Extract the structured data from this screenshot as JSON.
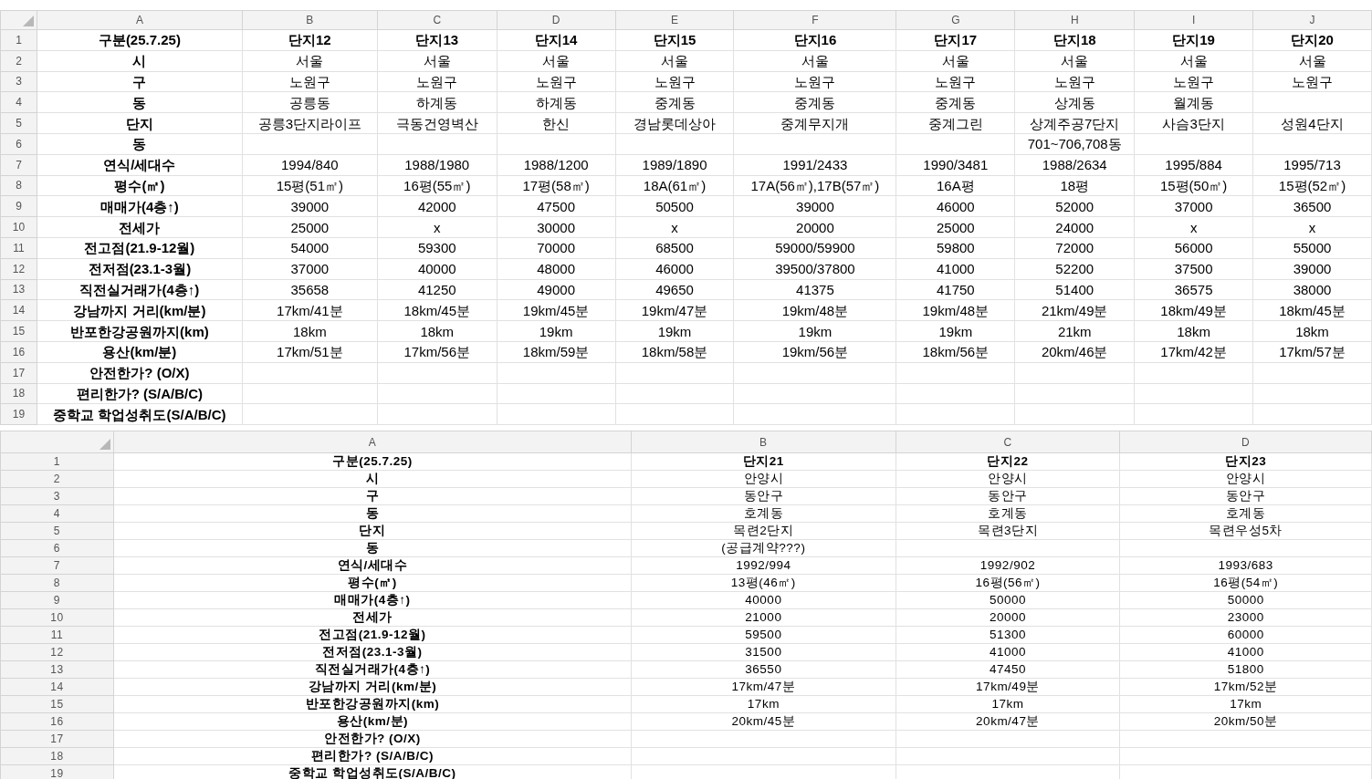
{
  "sheets": [
    {
      "columns": [
        "A",
        "B",
        "C",
        "D",
        "E",
        "F",
        "G",
        "H",
        "I",
        "J"
      ],
      "rows": [
        {
          "number": "1",
          "cells": [
            "구분(25.7.25)",
            "단지12",
            "단지13",
            "단지14",
            "단지15",
            "단지16",
            "단지17",
            "단지18",
            "단지19",
            "단지20"
          ]
        },
        {
          "number": "2",
          "cells": [
            "시",
            "서울",
            "서울",
            "서울",
            "서울",
            "서울",
            "서울",
            "서울",
            "서울",
            "서울"
          ]
        },
        {
          "number": "3",
          "cells": [
            "구",
            "노원구",
            "노원구",
            "노원구",
            "노원구",
            "노원구",
            "노원구",
            "노원구",
            "노원구",
            "노원구"
          ]
        },
        {
          "number": "4",
          "cells": [
            "동",
            "공릉동",
            "하계동",
            "하계동",
            "중계동",
            "중계동",
            "중계동",
            "상계동",
            "월계동",
            null
          ]
        },
        {
          "number": "5",
          "cells": [
            "단지",
            "공릉3단지라이프",
            "극동건영벽산",
            "한신",
            "경남롯데상아",
            "중계무지개",
            "중계그린",
            "상계주공7단지",
            "사슴3단지",
            "성원4단지"
          ]
        },
        {
          "number": "6",
          "cells": [
            "동",
            null,
            null,
            null,
            null,
            null,
            null,
            "701~706,708동",
            null,
            null
          ]
        },
        {
          "number": "7",
          "cells": [
            "연식/세대수",
            "1994/840",
            "1988/1980",
            "1988/1200",
            "1989/1890",
            "1991/2433",
            "1990/3481",
            "1988/2634",
            "1995/884",
            "1995/713"
          ]
        },
        {
          "number": "8",
          "cells": [
            "평수(㎡)",
            "15평(51㎡)",
            "16평(55㎡)",
            "17평(58㎡)",
            "18A(61㎡)",
            "17A(56㎡),17B(57㎡)",
            "16A평",
            "18평",
            "15평(50㎡)",
            "15평(52㎡)"
          ]
        },
        {
          "number": "9",
          "cells": [
            "매매가(4층↑)",
            "39000",
            "42000",
            "47500",
            "50500",
            "39000",
            "46000",
            "52000",
            "37000",
            "36500"
          ]
        },
        {
          "number": "10",
          "cells": [
            "전세가",
            "25000",
            "x",
            "30000",
            "x",
            "20000",
            "25000",
            "24000",
            "x",
            "x"
          ]
        },
        {
          "number": "11",
          "cells": [
            "전고점(21.9-12월)",
            "54000",
            "59300",
            "70000",
            "68500",
            "59000/59900",
            "59800",
            "72000",
            "56000",
            "55000"
          ]
        },
        {
          "number": "12",
          "cells": [
            "전저점(23.1-3월)",
            "37000",
            "40000",
            "48000",
            "46000",
            "39500/37800",
            "41000",
            "52200",
            "37500",
            "39000"
          ]
        },
        {
          "number": "13",
          "cells": [
            "직전실거래가(4층↑)",
            "35658",
            "41250",
            "49000",
            "49650",
            "41375",
            "41750",
            "51400",
            "36575",
            "38000"
          ]
        },
        {
          "number": "14",
          "cells": [
            "강남까지 거리(km/분)",
            "17km/41분",
            "18km/45분",
            "19km/45분",
            "19km/47분",
            "19km/48분",
            "19km/48분",
            "21km/49분",
            "18km/49분",
            "18km/45분"
          ]
        },
        {
          "number": "15",
          "cells": [
            "반포한강공원까지(km)",
            "18km",
            "18km",
            "19km",
            "19km",
            "19km",
            "19km",
            "21km",
            "18km",
            "18km"
          ]
        },
        {
          "number": "16",
          "cells": [
            "용산(km/분)",
            "17km/51분",
            "17km/56분",
            "18km/59분",
            "18km/58분",
            "19km/56분",
            "18km/56분",
            "20km/46분",
            "17km/42분",
            "17km/57분"
          ]
        },
        {
          "number": "17",
          "cells": [
            "안전한가? (O/X)",
            null,
            null,
            null,
            null,
            null,
            null,
            null,
            null,
            null
          ]
        },
        {
          "number": "18",
          "cells": [
            "편리한가? (S/A/B/C)",
            null,
            null,
            null,
            null,
            null,
            null,
            null,
            null,
            null
          ]
        },
        {
          "number": "19",
          "cells": [
            "중학교 학업성취도(S/A/B/C)",
            null,
            null,
            null,
            null,
            null,
            null,
            null,
            null,
            null
          ]
        }
      ]
    },
    {
      "columns": [
        "A",
        "B",
        "C",
        "D"
      ],
      "rows": [
        {
          "number": "1",
          "cells": [
            "구분(25.7.25)",
            "단지21",
            "단지22",
            "단지23"
          ]
        },
        {
          "number": "2",
          "cells": [
            "시",
            "안양시",
            "안양시",
            "안양시"
          ]
        },
        {
          "number": "3",
          "cells": [
            "구",
            "동안구",
            "동안구",
            "동안구"
          ]
        },
        {
          "number": "4",
          "cells": [
            "동",
            "호계동",
            "호계동",
            "호계동"
          ]
        },
        {
          "number": "5",
          "cells": [
            "단지",
            "목련2단지",
            "목련3단지",
            "목련우성5차"
          ]
        },
        {
          "number": "6",
          "cells": [
            "동",
            "(공급계약???)",
            null,
            null
          ]
        },
        {
          "number": "7",
          "cells": [
            "연식/세대수",
            "1992/994",
            "1992/902",
            "1993/683"
          ]
        },
        {
          "number": "8",
          "cells": [
            "평수(㎡)",
            "13평(46㎡)",
            "16평(56㎡)",
            "16평(54㎡)"
          ]
        },
        {
          "number": "9",
          "cells": [
            "매매가(4층↑)",
            "40000",
            "50000",
            "50000"
          ]
        },
        {
          "number": "10",
          "cells": [
            "전세가",
            "21000",
            "20000",
            "23000"
          ]
        },
        {
          "number": "11",
          "cells": [
            "전고점(21.9-12월)",
            "59500",
            "51300",
            "60000"
          ]
        },
        {
          "number": "12",
          "cells": [
            "전저점(23.1-3월)",
            "31500",
            "41000",
            "41000"
          ]
        },
        {
          "number": "13",
          "cells": [
            "직전실거래가(4층↑)",
            "36550",
            "47450",
            "51800"
          ]
        },
        {
          "number": "14",
          "cells": [
            "강남까지 거리(km/분)",
            "17km/47분",
            "17km/49분",
            "17km/52분"
          ]
        },
        {
          "number": "15",
          "cells": [
            "반포한강공원까지(km)",
            "17km",
            "17km",
            "17km"
          ]
        },
        {
          "number": "16",
          "cells": [
            "용산(km/분)",
            "20km/45분",
            "20km/47분",
            "20km/50분"
          ]
        },
        {
          "number": "17",
          "cells": [
            "안전한가? (O/X)",
            null,
            null,
            null
          ]
        },
        {
          "number": "18",
          "cells": [
            "편리한가? (S/A/B/C)",
            null,
            null,
            null
          ]
        },
        {
          "number": "19",
          "cells": [
            "중학교 학업성취도(S/A/B/C)",
            null,
            null,
            null
          ]
        }
      ]
    }
  ]
}
